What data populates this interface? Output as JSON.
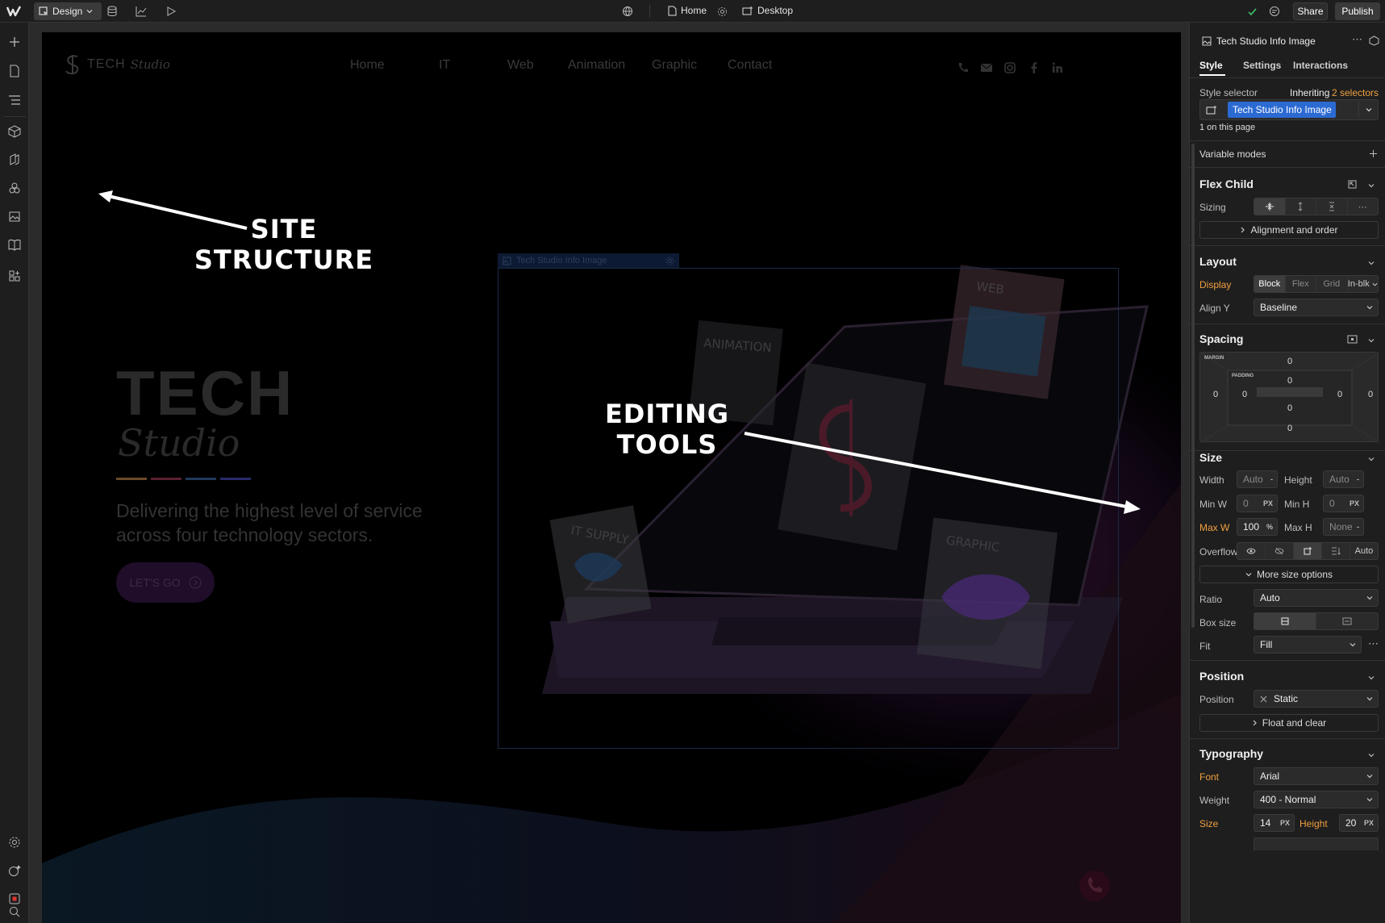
{
  "topbar": {
    "mode_label": "Design",
    "page_label": "Home",
    "breakpoint_label": "Desktop",
    "share_label": "Share",
    "publish_label": "Publish"
  },
  "site": {
    "logo_text": "TECH",
    "logo_script": "Studio",
    "nav": [
      "Home",
      "IT",
      "Web",
      "Animation",
      "Graphic",
      "Contact"
    ],
    "hero_title": "TECH",
    "hero_script": "Studio",
    "tagline": "Delivering the highest level of service across four technology sectors.",
    "cta_label": "LET'S GO",
    "accent_lines": [
      "#6b4a2a",
      "#5a2030",
      "#1f3a5a",
      "#2a2a6a"
    ],
    "cards": [
      "ANIMATION",
      "WEB",
      "IT SUPPLY",
      "GRAPHIC"
    ]
  },
  "selection": {
    "tag_label": "Tech Studio Info Image"
  },
  "annotations": {
    "site_structure": [
      "SITE",
      "STRUCTURE"
    ],
    "editing_tools": [
      "EDITING",
      "TOOLS"
    ]
  },
  "panel": {
    "element_name": "Tech Studio Info Image",
    "tabs": [
      "Style",
      "Settings",
      "Interactions"
    ],
    "style_selector_label": "Style selector",
    "inheriting_label": "Inheriting",
    "inheriting_count": "2 selectors",
    "selector_chip": "Tech Studio Info Image",
    "on_page": "1 on this page",
    "variable_modes": "Variable modes",
    "flex_child": {
      "title": "Flex Child",
      "sizing_label": "Sizing",
      "alignment_btn": "Alignment and order"
    },
    "layout": {
      "title": "Layout",
      "display_label": "Display",
      "display_options": [
        "Block",
        "Flex",
        "Grid",
        "In-blk"
      ],
      "aligny_label": "Align Y",
      "aligny_value": "Baseline"
    },
    "spacing": {
      "title": "Spacing",
      "margin_label": "MARGIN",
      "padding_label": "PADDING",
      "margin": {
        "top": "0",
        "right": "0",
        "bottom": "0",
        "left": "0"
      },
      "padding": {
        "top": "0",
        "right": "0",
        "bottom": "0",
        "left": "0"
      }
    },
    "size": {
      "title": "Size",
      "width_label": "Width",
      "width_value": "Auto",
      "width_unit": "-",
      "height_label": "Height",
      "height_value": "Auto",
      "height_unit": "-",
      "minw_label": "Min W",
      "minw_value": "0",
      "minw_unit": "PX",
      "minh_label": "Min H",
      "minh_value": "0",
      "minh_unit": "PX",
      "maxw_label": "Max W",
      "maxw_value": "100",
      "maxw_unit": "%",
      "maxh_label": "Max H",
      "maxh_value": "None",
      "maxh_unit": "-",
      "overflow_label": "Overflow",
      "overflow_auto": "Auto",
      "more_btn": "More size options",
      "ratio_label": "Ratio",
      "ratio_value": "Auto",
      "boxsize_label": "Box size",
      "fit_label": "Fit",
      "fit_value": "Fill"
    },
    "position": {
      "title": "Position",
      "position_label": "Position",
      "position_value": "Static",
      "float_btn": "Float and clear"
    },
    "typography": {
      "title": "Typography",
      "font_label": "Font",
      "font_value": "Arial",
      "weight_label": "Weight",
      "weight_value": "400 - Normal",
      "size_label": "Size",
      "size_value": "14",
      "size_unit": "PX",
      "height_label": "Height",
      "height_value": "20",
      "height_unit": "PX"
    }
  },
  "colors": {
    "accent_blue": "#2c6ad3",
    "orange": "#f0a040",
    "panel_bg": "#1e1e1e"
  }
}
